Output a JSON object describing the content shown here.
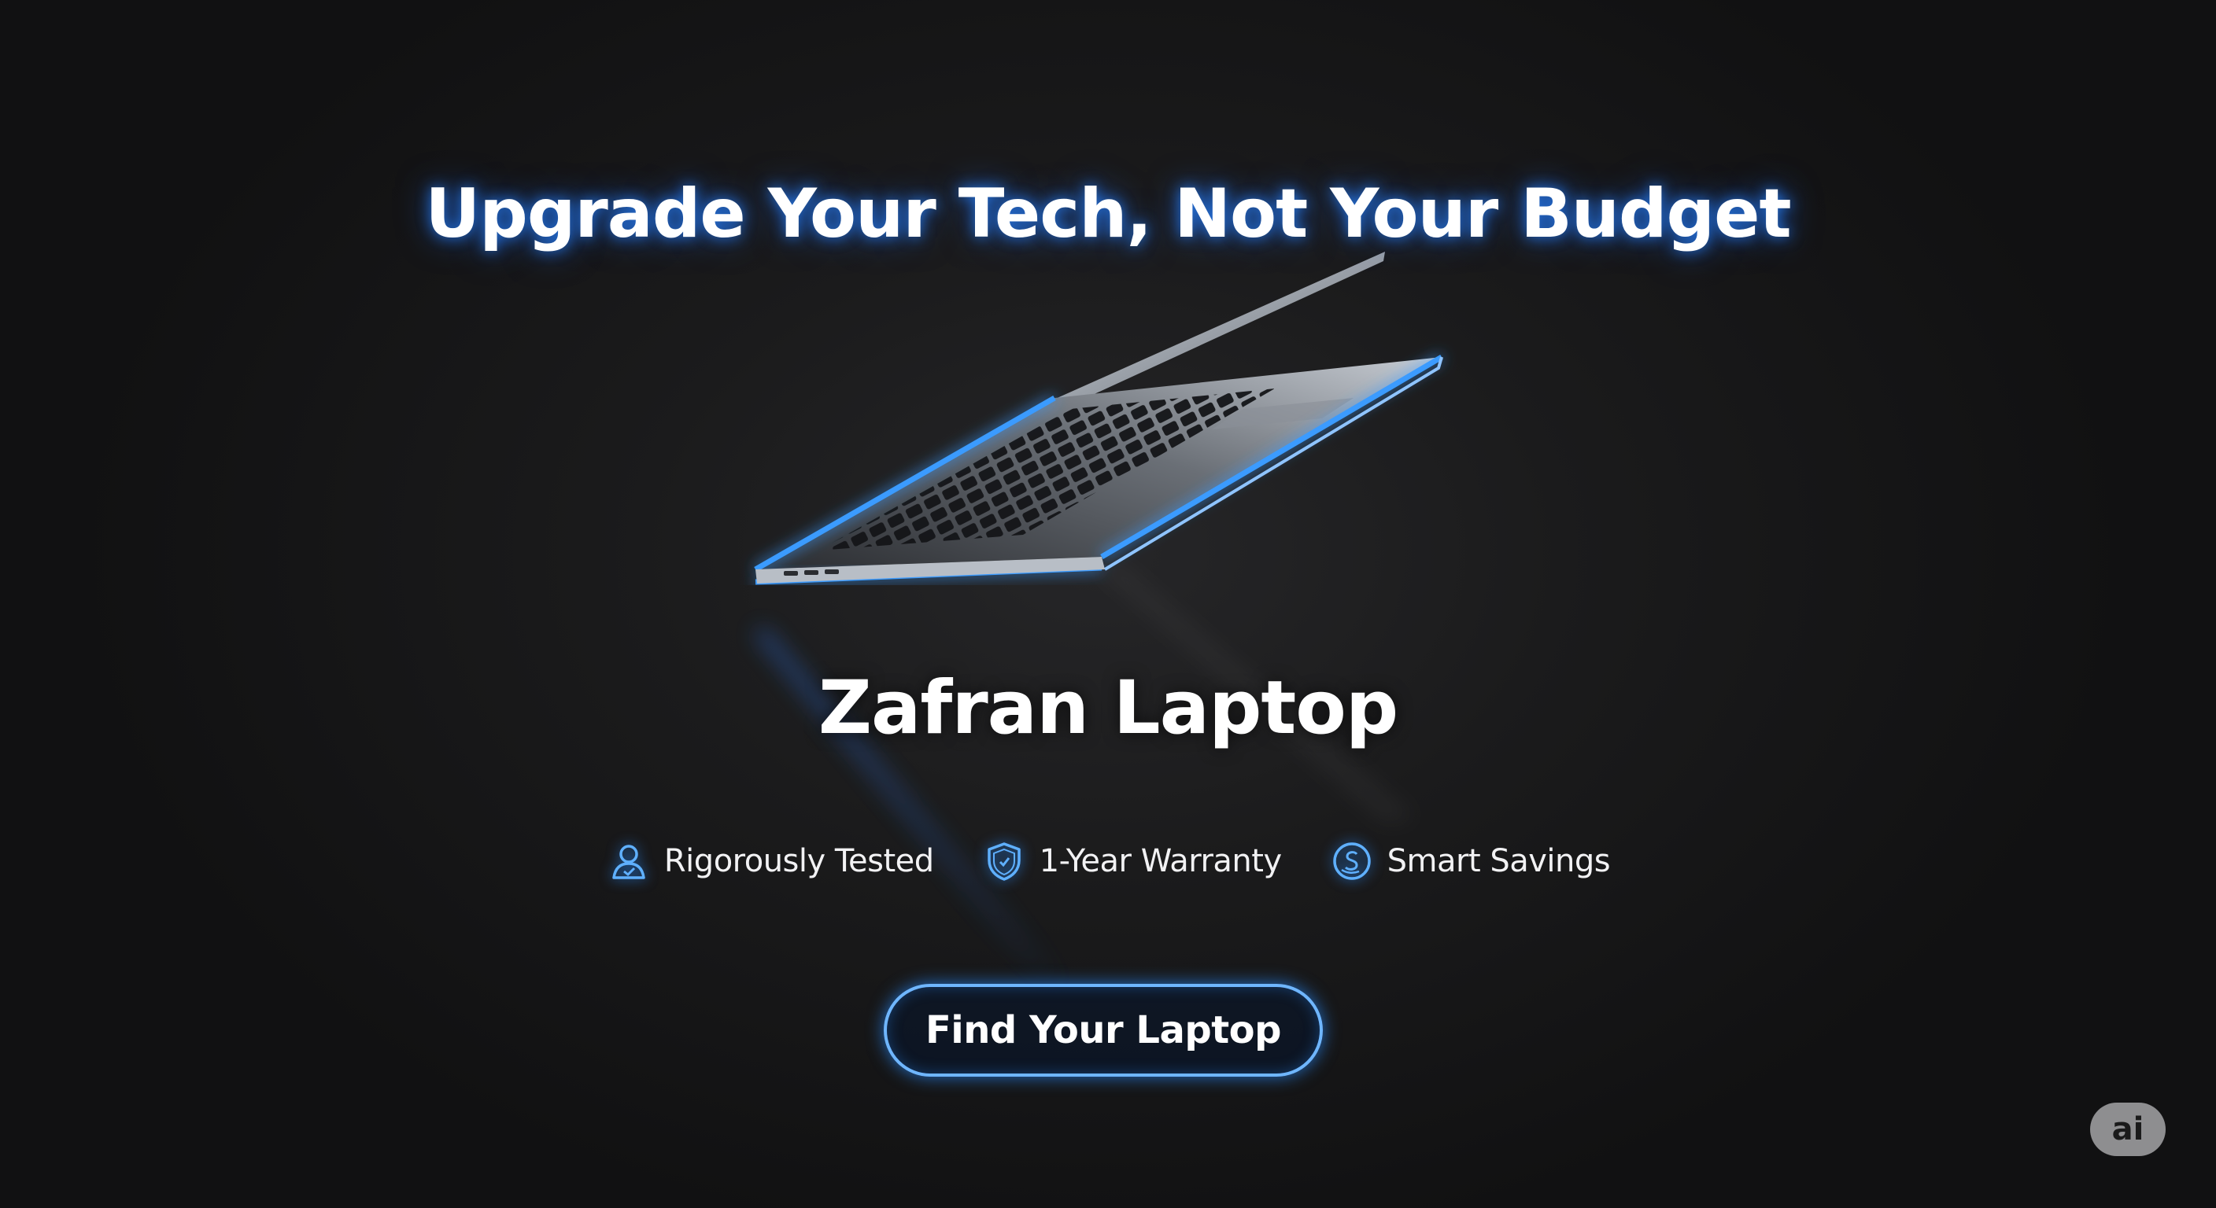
{
  "hero": {
    "headline": "Upgrade Your Tech, Not Your Budget",
    "product_name": "Zafran Laptop"
  },
  "features": [
    {
      "icon": "user-check-icon",
      "label": "Rigorously Tested"
    },
    {
      "icon": "shield-icon",
      "label": "1-Year Warranty"
    },
    {
      "icon": "savings-icon",
      "label": "Smart Savings"
    }
  ],
  "cta": {
    "label": "Find Your Laptop"
  },
  "badge": {
    "label": "ai"
  },
  "colors": {
    "background": "#1b1b1c",
    "accent_glow": "#2a8cff",
    "button_border": "#6fb6ff",
    "text": "#ffffff",
    "badge": "#8e8e90"
  }
}
